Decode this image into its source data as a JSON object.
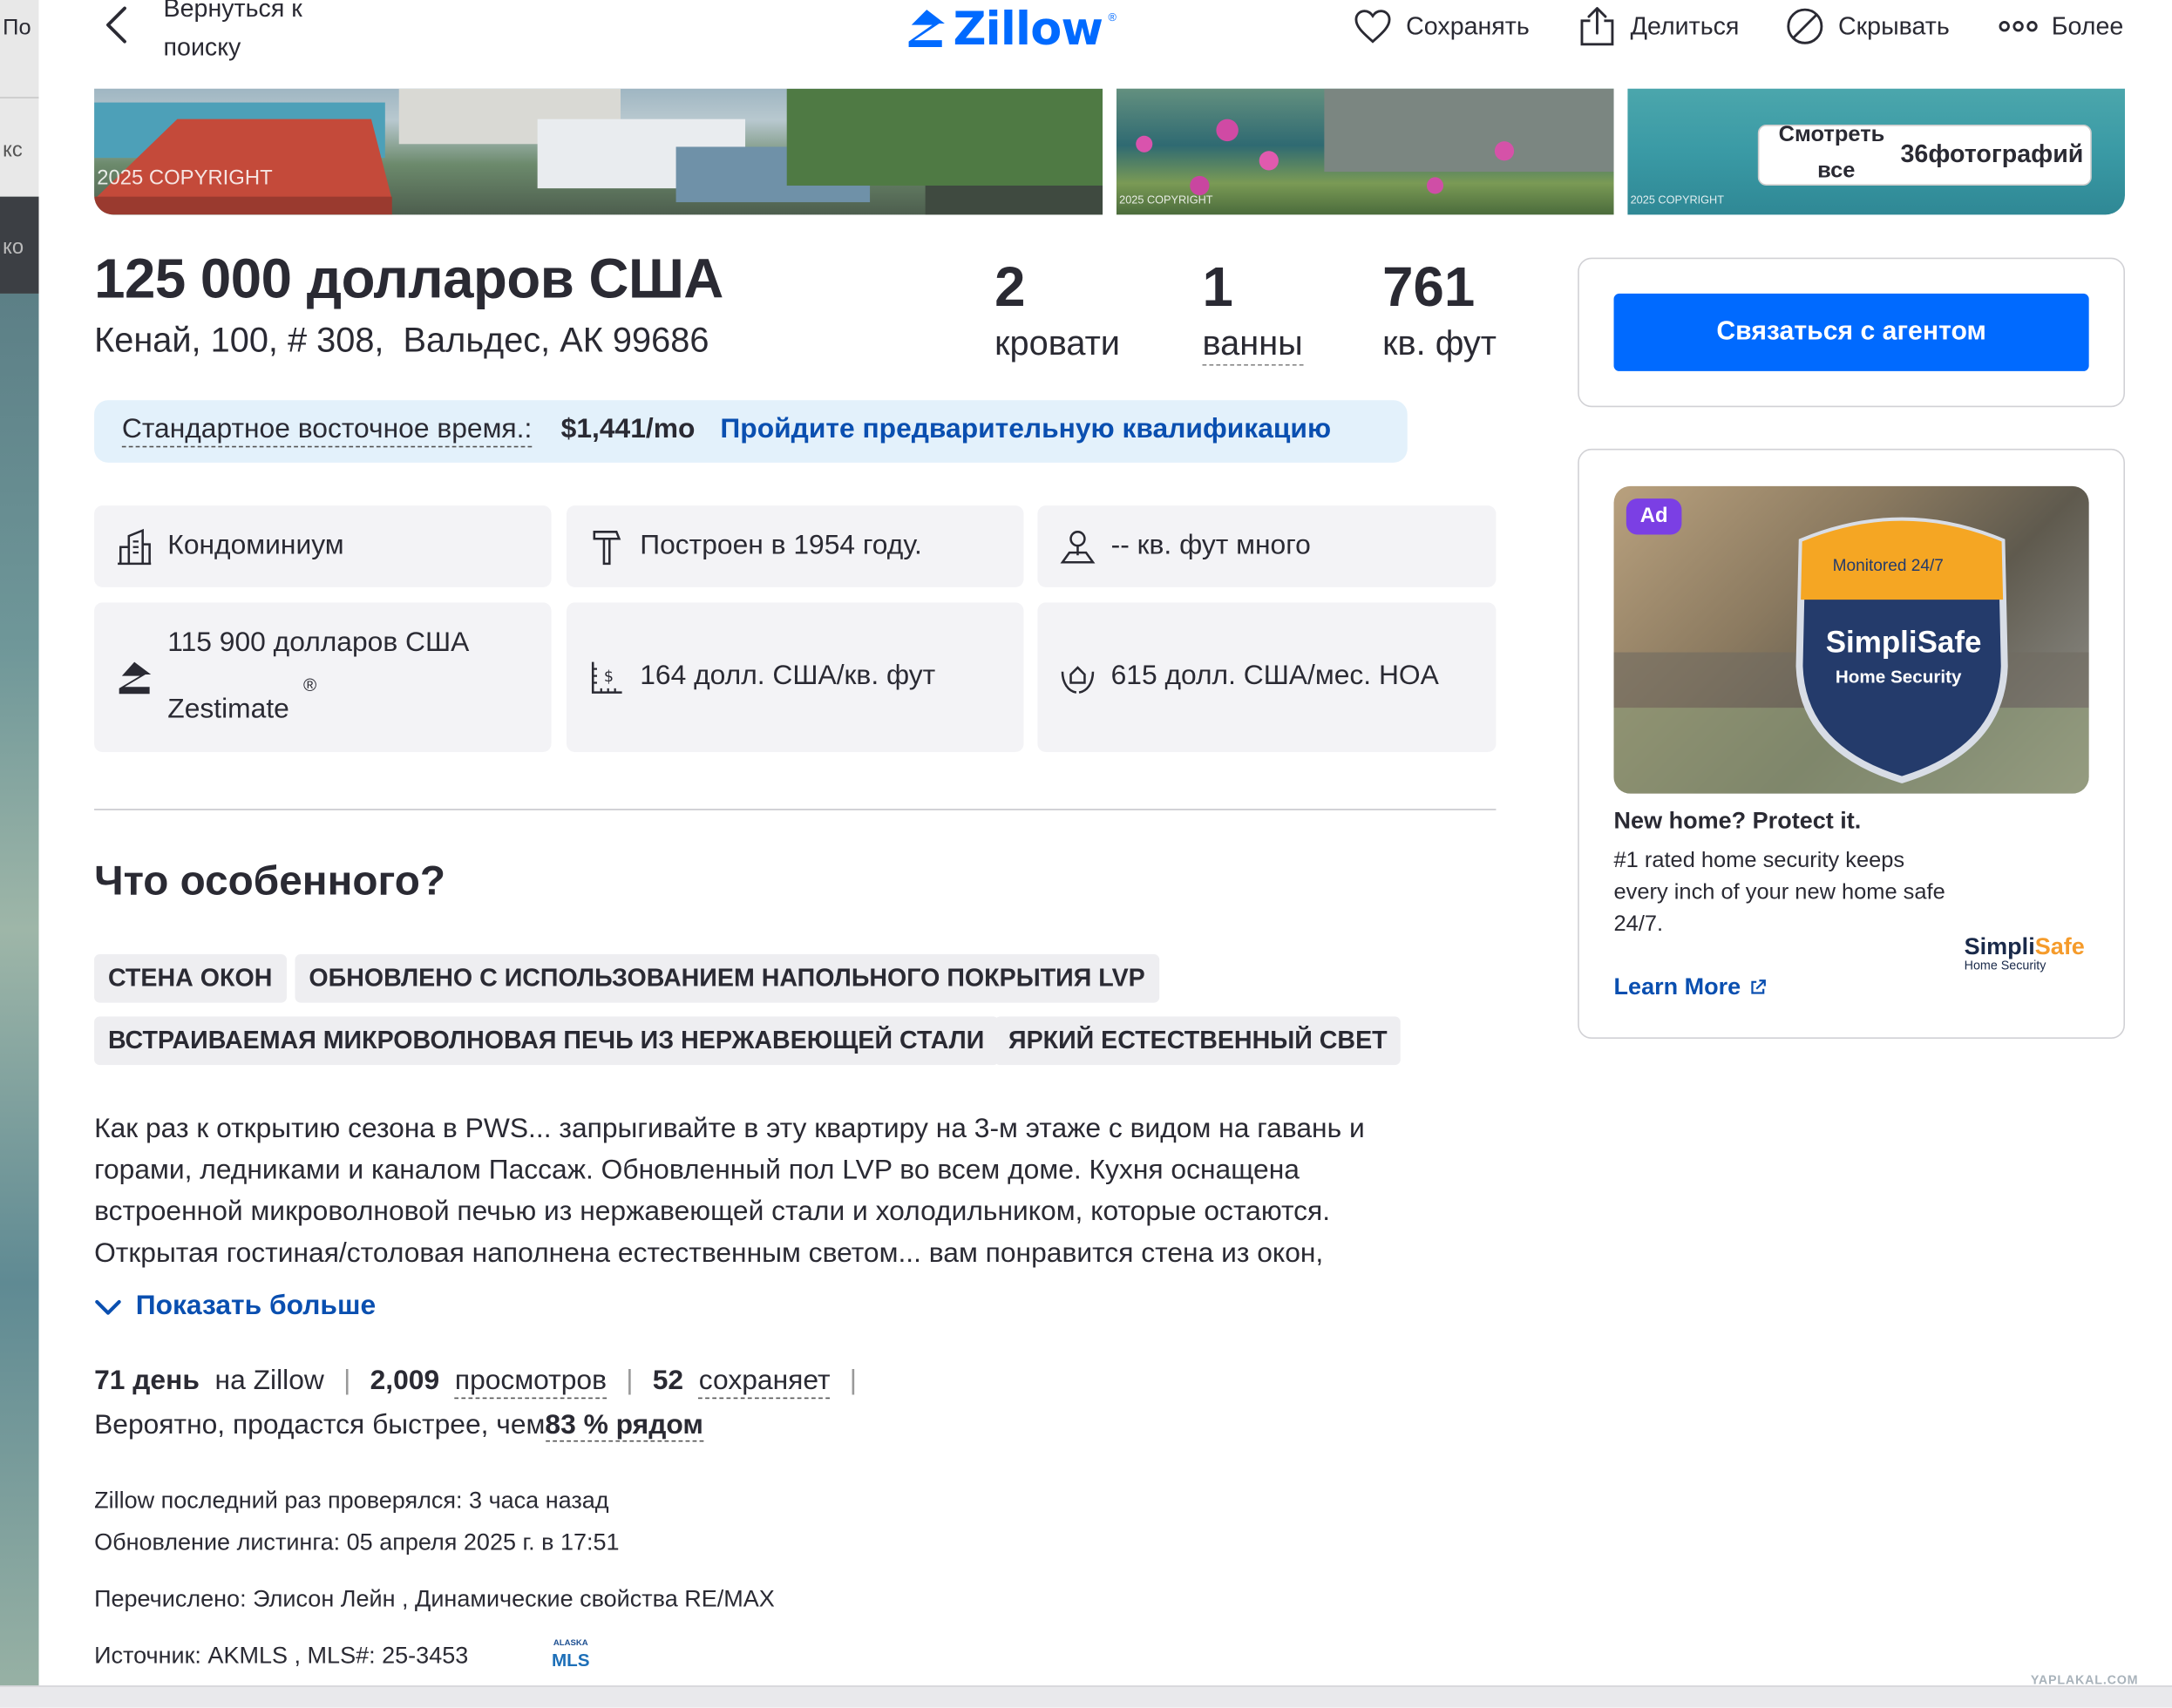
{
  "left_strip": {
    "frag_top": "По",
    "frag_mid": "кс",
    "frag_dark": "ко"
  },
  "header": {
    "back_label": "Вернуться к поиску",
    "logo_text": "Zillow",
    "logo_reg": "®",
    "actions": {
      "save": "Сохранять",
      "share": "Делиться",
      "hide": "Скрывать",
      "more": "Более"
    }
  },
  "photos": {
    "copyright_1": "2025 COPYRIGHT",
    "copyright_2": "2025 COPYRIGHT",
    "copyright_3": "2025 COPYRIGHT",
    "see_all_line1": "Смотреть",
    "see_all_line2": "все",
    "see_all_count": "36фотографий"
  },
  "listing": {
    "price": "125 000 долларов США",
    "address": "Кенай, 100, # 308,  Вальдес, АК 99686",
    "beds_num": "2",
    "beds_label": "кровати",
    "baths_num": "1",
    "baths_label": "ванны",
    "sqft_num": "761",
    "sqft_label": "кв. фут"
  },
  "payment": {
    "label": "Стандартное восточное время.",
    "colon": ":",
    "value": "$1,441/mo",
    "action": "Пройдите предварительную квалификацию"
  },
  "facts": {
    "type": "Кондоминиум",
    "built": "Построен в 1954 году.",
    "lot": "-- кв. фут много",
    "zestimate_value": "115 900 долларов США",
    "zestimate_label": "Zestimate",
    "zestimate_reg": "®",
    "price_per_sqft": "164 долл. США/кв. фут",
    "hoa": "615 долл. США/мес. HOA"
  },
  "special": {
    "title": "Что особенного?",
    "chips": [
      "СТЕНА ОКОН",
      "ОБНОВЛЕНО С ИСПОЛЬЗОВАНИЕМ НАПОЛЬНОГО ПОКРЫТИЯ LVP",
      "ВСТРАИВАЕМАЯ МИКРОВОЛНОВАЯ ПЕЧЬ ИЗ НЕРЖАВЕЮЩЕЙ СТАЛИ",
      "ЯРКИЙ ЕСТЕСТВЕННЫЙ СВЕТ"
    ],
    "description_lines": [
      "Как раз к открытию сезона в PWS... запрыгивайте в эту квартиру на 3-м этаже с видом на гавань и",
      "горами, ледниками и каналом Пассаж. Обновленный пол LVP во всем доме. Кухня оснащена",
      "встроенной микроволновой печью из нержавеющей стали и холодильником, которые остаются.",
      "Открытая гостиная/столовая наполнена естественным светом... вам понравится стена из окон,"
    ],
    "show_more": "Показать больше"
  },
  "metrics": {
    "days_num": "71 день",
    "days_text": "на Zillow",
    "views_num": "2,009",
    "views_text": "просмотров",
    "saves_num": "52",
    "saves_text": "сохраняет",
    "likely_text": "Вероятно, продастся быстрее, чем",
    "likely_pct": "83 % рядом"
  },
  "meta": {
    "checked": "Zillow последний раз проверялся: 3 часа назад",
    "updated": "Обновление листинга: 05 апреля 2025 г. в 17:51",
    "listed_by": "Перечислено: Элисон Лейн , Динамические свойства RE/MAX",
    "source": "Источник: AKMLS ,   MLS#: 25-3453",
    "mls_logo_line1": "ALASKA",
    "mls_logo_line2": "MLS"
  },
  "agent": {
    "button": "Связаться с агентом"
  },
  "ad": {
    "badge": "Ad",
    "sign_top": "Monitored 24/7",
    "sign_brand": "SimpliSafe",
    "sign_sub": "Home Security",
    "title": "New home? Protect it.",
    "body": "#1 rated home security keeps every inch of your new home safe 24/7.",
    "learn_more": "Learn More",
    "logo_simpli": "Simpli",
    "logo_safe": "Safe",
    "logo_sub": "Home Security"
  },
  "watermark": "YAPLAKAL.COM",
  "colors": {
    "brand_blue": "#006aff",
    "link_blue": "#0a4fb0",
    "ad_purple": "#7b3fe4"
  }
}
